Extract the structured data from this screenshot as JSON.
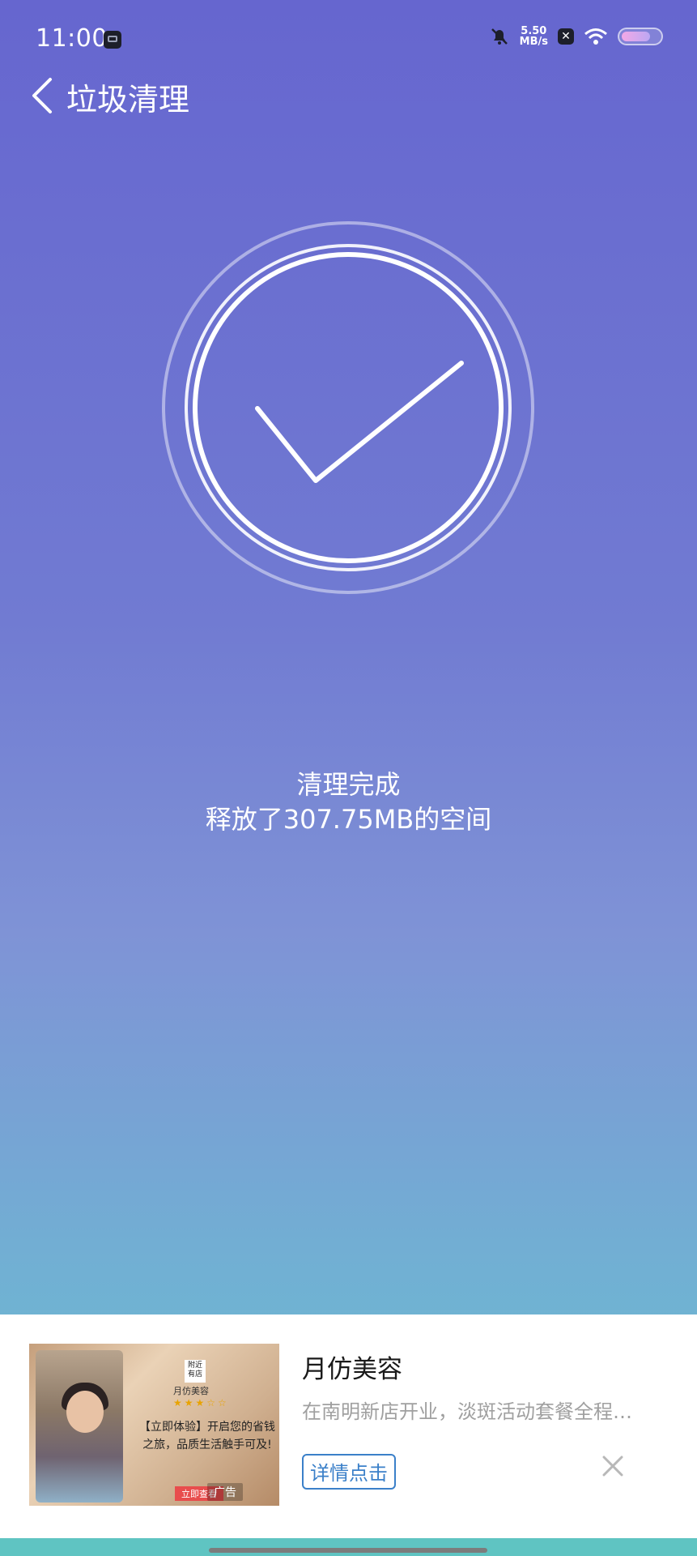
{
  "status_bar": {
    "time": "11:00",
    "net_speed_value": "5.50",
    "net_speed_unit": "MB/s",
    "x_badge": "✕",
    "battery_level": 0.78
  },
  "header": {
    "title": "垃圾清理"
  },
  "result": {
    "title": "清理完成",
    "detail": "释放了307.75MB的空间"
  },
  "ad": {
    "title": "月仿美容",
    "description": "在南明新店开业，淡斑活动套餐全程…",
    "button_label": "详情点击",
    "image": {
      "logo_text": "附近有店",
      "shop_name": "月仿美容",
      "stars": "★★★☆☆",
      "promo": "【立即体验】开启您的省钱之旅，品质生活触手可及!",
      "cta": "立即查看",
      "ad_tag": "广告"
    }
  },
  "colors": {
    "gradient_top": "#6666cf",
    "gradient_bottom": "#67c3d1",
    "ad_button": "#3b80c9"
  }
}
